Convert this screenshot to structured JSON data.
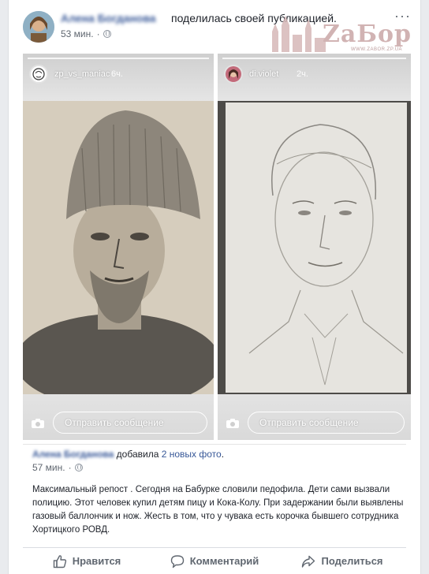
{
  "header": {
    "author_name": "Алена Богданова",
    "shared_text": "поделилась своей публикацией.",
    "time": "53 мин.",
    "more_glyph": "···"
  },
  "watermark": {
    "logo": "ZаБор",
    "url": "WWW.ZABOR.ZP.UA"
  },
  "stories": [
    {
      "username": "zp_vs_maniac",
      "time": "6ч.",
      "message_placeholder": "Отправить сообщение"
    },
    {
      "username": "di.violet",
      "time": "2ч.",
      "message_placeholder": "Отправить сообщение"
    }
  ],
  "repost": {
    "author_name": "Алена Богданова",
    "action_text": "добавила",
    "link_text": "2 новых фото",
    "period": ".",
    "time": "57 мин.",
    "body": "Максимальный репост . Сегодня на Бабурке словили педофила. Дети сами вызвали полицию. Этот человек купил детям пицу и Кока-Колу. При задержании были выявлены газовый баллончик и нож. Жесть в том, что у чувака есть корочка бывшего сотрудника Хортицкого РОВД."
  },
  "actions": {
    "like": "Нравится",
    "comment": "Комментарий",
    "share": "Поделиться"
  },
  "colors": {
    "link": "#385898",
    "muted": "#606770",
    "background": "#e9ebee"
  },
  "icons": [
    "globe-icon",
    "more-icon",
    "camera-icon",
    "like-icon",
    "comment-icon",
    "share-icon"
  ]
}
